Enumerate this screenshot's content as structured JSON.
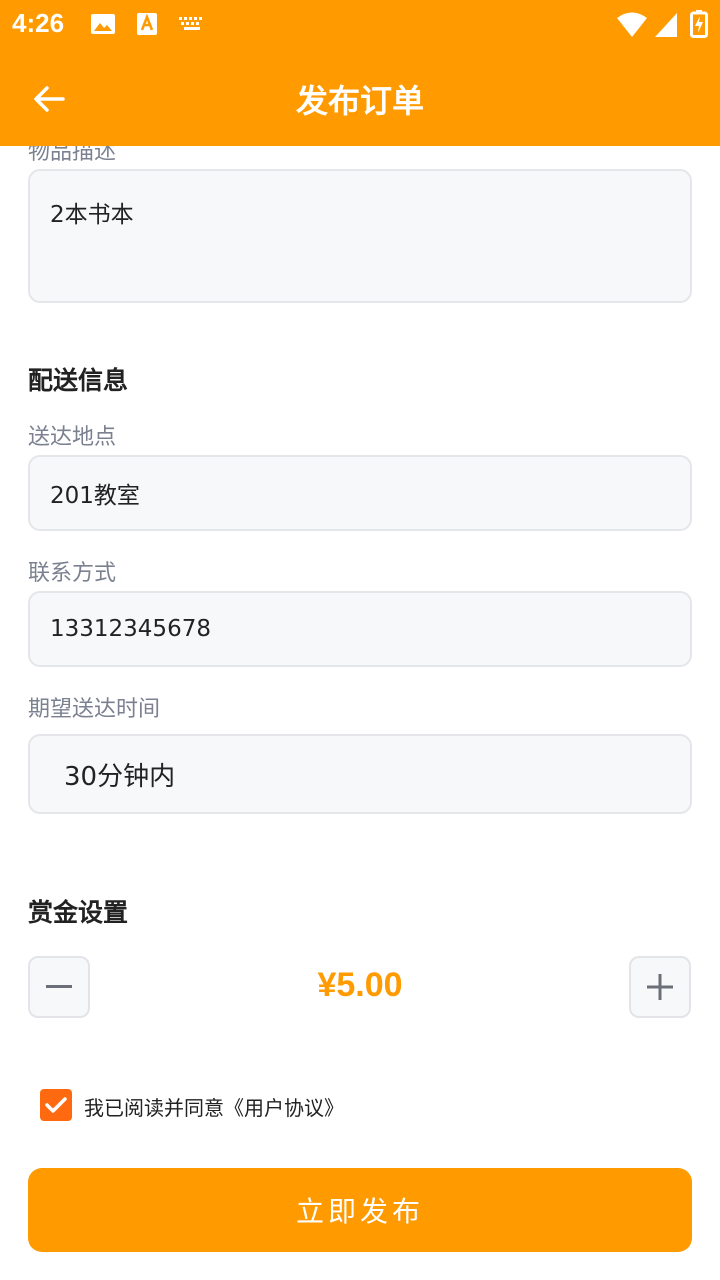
{
  "status_bar": {
    "time": "4:26",
    "icons": [
      "image-icon",
      "text-a-icon",
      "keyboard-icon",
      "wifi-icon",
      "signal-icon",
      "battery-charging-icon"
    ]
  },
  "app_bar": {
    "title": "发布订单",
    "back_icon": "arrow-left-icon"
  },
  "item": {
    "label": "物品描述",
    "value": "2本书本"
  },
  "delivery": {
    "section_title": "配送信息",
    "address_label": "送达地点",
    "address_value": "201教室",
    "contact_label": "联系方式",
    "contact_value": "13312345678",
    "time_label": "期望送达时间",
    "time_value": "30分钟内"
  },
  "reward": {
    "section_title": "赏金设置",
    "amount": "¥5.00",
    "minus_icon": "minus-icon",
    "plus_icon": "plus-icon"
  },
  "agreement": {
    "checked": true,
    "text": "我已阅读并同意《用户协议》"
  },
  "submit": {
    "label": "立即发布"
  },
  "colors": {
    "accent": "#FF9A00",
    "checkbox": "#FF6A10",
    "field_bg": "#f7f8fa",
    "label_text": "#7b8190"
  }
}
